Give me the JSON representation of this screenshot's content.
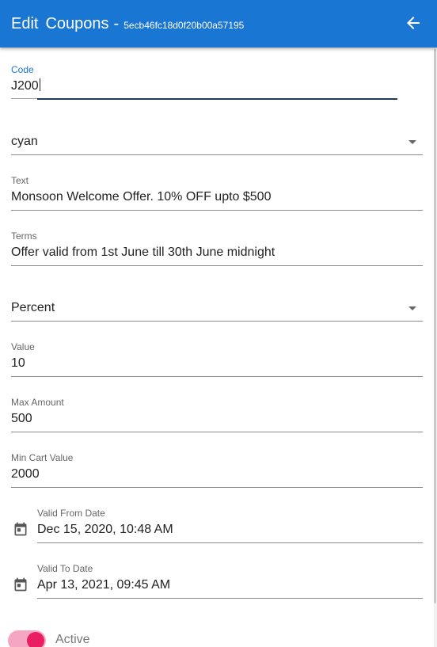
{
  "header": {
    "title_word1": "Edit",
    "title_word2": "Coupons",
    "separator": "-",
    "record_id": "5ecb46fc18d0f20b00a57195",
    "back_icon": "arrow-left-icon"
  },
  "form": {
    "code": {
      "label": "Code",
      "value": "J200"
    },
    "color": {
      "value": "cyan"
    },
    "text": {
      "label": "Text",
      "value": "Monsoon Welcome Offer. 10% OFF upto $500"
    },
    "terms": {
      "label": "Terms",
      "value": "Offer valid from 1st June till 30th June midnight"
    },
    "discount_type": {
      "value": "Percent"
    },
    "value": {
      "label": "Value",
      "value": "10"
    },
    "max_amount": {
      "label": "Max Amount",
      "value": "500"
    },
    "min_cart_value": {
      "label": "Min Cart Value",
      "value": "2000"
    },
    "valid_from": {
      "label": "Valid From Date",
      "value": "Dec 15, 2020, 10:48 AM",
      "icon": "calendar-icon"
    },
    "valid_to": {
      "label": "Valid To Date",
      "value": "Apr 13, 2021, 09:45 AM",
      "icon": "calendar-icon"
    },
    "active": {
      "label": "Active",
      "checked": true
    }
  },
  "colors": {
    "primary": "#1976d2",
    "toggle_thumb": "#e91e63",
    "toggle_track": "#f5a6c3"
  }
}
